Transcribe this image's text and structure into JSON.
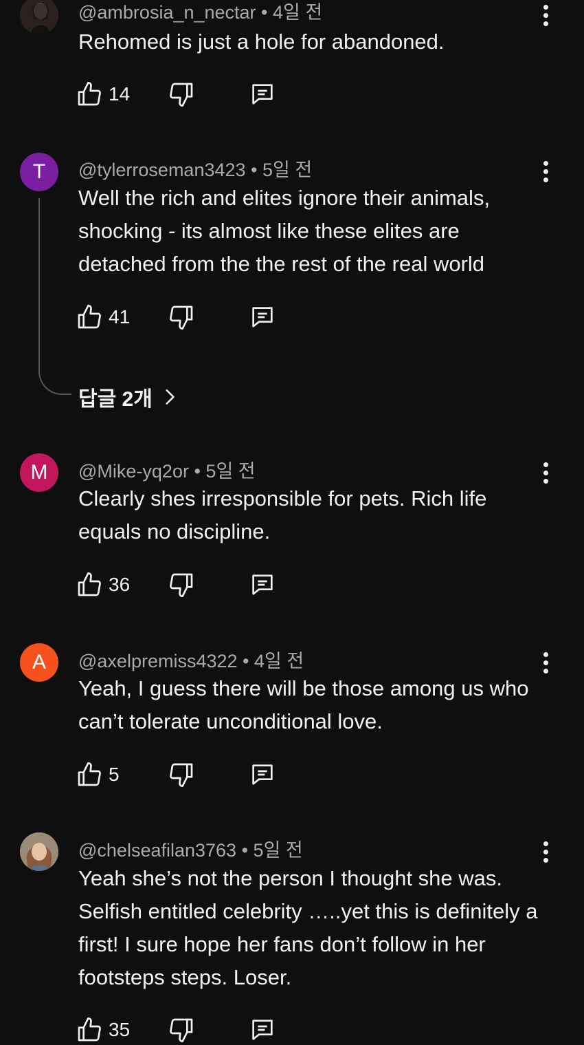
{
  "comments": [
    {
      "author": "@ambrosia_n_nectar",
      "time": "4일 전",
      "text": "Rehomed is just a hole for abandoned.",
      "likes": "14",
      "avatar_letter": "",
      "avatar_color": "#3a2a2a"
    },
    {
      "author": "@tylerroseman3423",
      "time": "5일 전",
      "text": "Well the rich and elites ignore their animals, shocking - its almost like these elites are detached from the the rest of the real world",
      "likes": "41",
      "avatar_letter": "T",
      "avatar_color": "#7b1fa2",
      "replies_label": "답글 2개"
    },
    {
      "author": "@Mike-yq2or",
      "time": "5일 전",
      "text": "Clearly shes irresponsible for pets. Rich life equals no discipline.",
      "likes": "36",
      "avatar_letter": "M",
      "avatar_color": "#c2185b"
    },
    {
      "author": "@axelpremiss4322",
      "time": "4일 전",
      "text": "Yeah, I guess there will be those among us who can’t tolerate unconditional love.",
      "likes": "5",
      "avatar_letter": "A",
      "avatar_color": "#f4511e"
    },
    {
      "author": "@chelseafilan3763",
      "time": "5일 전",
      "text": "Yeah she’s not the person I thought she was. Selfish entitled celebrity …..yet this is definitely a first! I sure hope her fans don’t follow in her footsteps steps.  Loser.",
      "likes": "35",
      "avatar_letter": "",
      "avatar_color": "#8d6e63"
    }
  ],
  "separator": " • ",
  "icons": {
    "like": "thumb-up-icon",
    "dislike": "thumb-down-icon",
    "reply": "comment-reply-icon",
    "more": "more-vert-icon",
    "chevron": "chevron-right-icon"
  }
}
